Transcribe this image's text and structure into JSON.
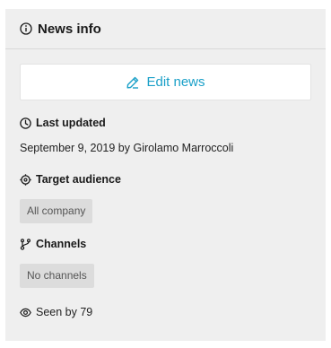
{
  "panel": {
    "title": "News info",
    "edit_button_label": "Edit news"
  },
  "last_updated": {
    "label": "Last updated",
    "value": "September 9, 2019 by Girolamo Marroccoli"
  },
  "target_audience": {
    "label": "Target audience",
    "chip": "All company"
  },
  "channels": {
    "label": "Channels",
    "chip": "No channels"
  },
  "seen": {
    "text": "Seen by 79"
  },
  "colors": {
    "accent": "#1aa0c8",
    "panel_bg": "#efefef",
    "chip_bg": "#dcdcdc"
  },
  "icons": [
    "info-icon",
    "pencil-icon",
    "clock-icon",
    "target-icon",
    "branch-icon",
    "eye-icon"
  ]
}
